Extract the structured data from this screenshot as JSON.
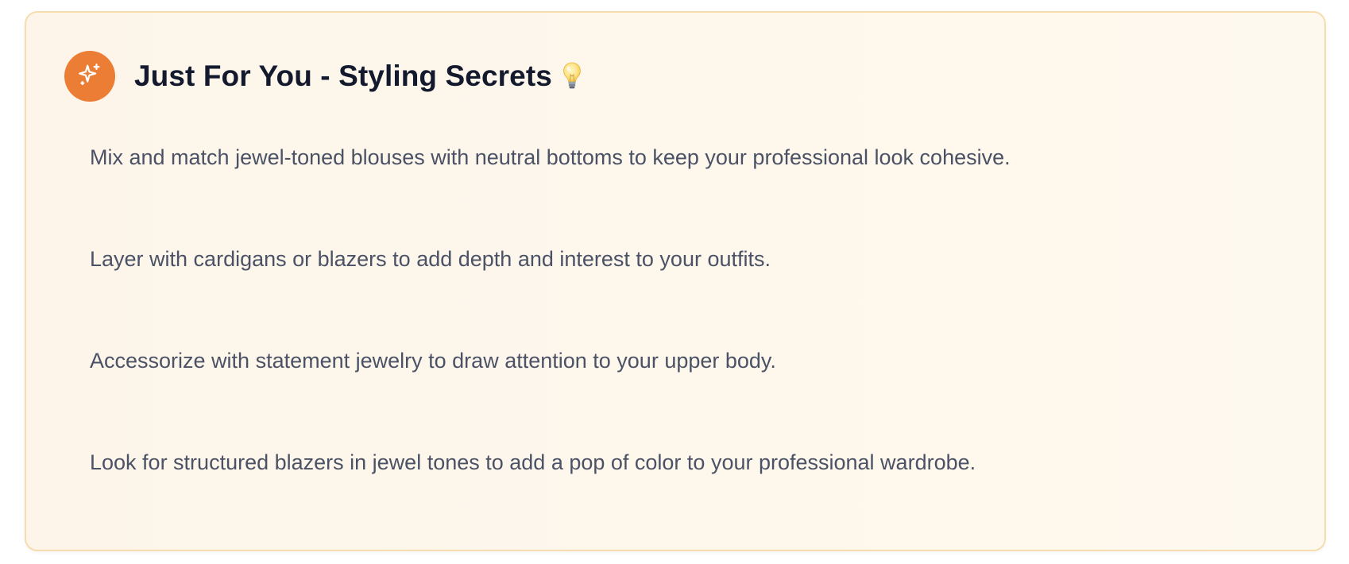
{
  "card": {
    "title": "Just For You - Styling Secrets",
    "title_icon": "sparkles-icon",
    "emoji_icon": "light-bulb-icon",
    "accent_color": "#ec7d34",
    "border_color": "#f6dcae",
    "background_color": "#fdf7ec",
    "tips": [
      "Mix and match jewel-toned blouses with neutral bottoms to keep your professional look cohesive.",
      "Layer with cardigans or blazers to add depth and interest to your outfits.",
      "Accessorize with statement jewelry to draw attention to your upper body.",
      "Look for structured blazers in jewel tones to add a pop of color to your professional wardrobe."
    ]
  }
}
